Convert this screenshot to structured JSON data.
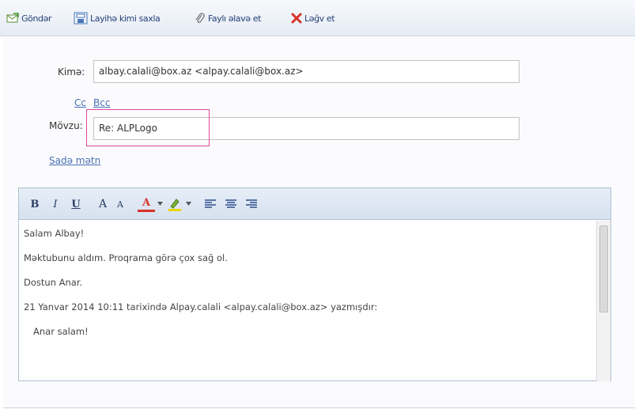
{
  "toolbar": {
    "send_label": "Göndər",
    "save_draft_label": "Layihə kimi saxla",
    "attach_label": "Faylı əlavə et",
    "cancel_label": "Ləğv et"
  },
  "compose": {
    "to_label": "Kimə:",
    "to_value": "albay.calali@box.az <alpay.calali@box.az>",
    "cc_link": "Cc",
    "bcc_link": "Bcc",
    "subject_label": "Mövzu:",
    "subject_value": "Re: ALPLogo",
    "plain_text_link": "Sadə mətn"
  },
  "editor": {
    "format_buttons": {
      "bold": "B",
      "italic": "I",
      "underline": "U",
      "grow_font": "A",
      "shrink_font": "A",
      "font_color": "A"
    },
    "lines": [
      "Salam Albay!",
      "Məktubunu aldım. Proqrama görə çox sağ ol.",
      "Dostun Anar.",
      "21 Yanvar 2014 10:11 tarixində Alpay.calali <alpay.calali@box.az> yazmışdır:",
      "Anar salam!"
    ]
  },
  "colors": {
    "highlight_border": "#e2479c",
    "link": "#4a6fb5",
    "cancel_icon": "#d8322a",
    "font_color_icon": "#d8322a",
    "highlight_color_icon": "#e8d400"
  }
}
